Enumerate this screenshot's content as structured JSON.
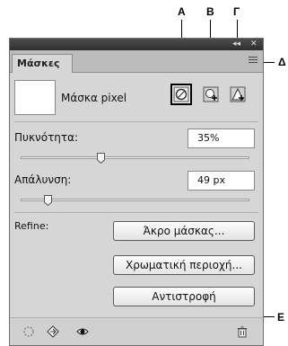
{
  "callouts": {
    "a": "A",
    "b": "B",
    "g": "Γ",
    "d": "Δ",
    "e": "E"
  },
  "panel": {
    "title_buttons": {
      "collapse": "◂◂",
      "close": "✕"
    },
    "tab_label": "Μάσκες",
    "mask_type": "Μάσκα pixel",
    "icons": {
      "pixel_mask": "pixel-mask-icon",
      "add_pixel_mask": "add-pixel-mask-icon",
      "add_vector_mask": "add-vector-mask-icon",
      "panel_menu": "panel-menu-icon"
    },
    "density": {
      "label": "Πυκνότητα:",
      "value": "35%",
      "fraction": 0.35
    },
    "feather": {
      "label": "Απάλυνση:",
      "value": "49 px",
      "fraction": 0.12
    },
    "refine": {
      "label": "Refine:",
      "mask_edge": "Άκρο μάσκας...",
      "color_range": "Χρωματική περιοχή...",
      "invert": "Αντιστροφή"
    },
    "bottom_icons": [
      "load-selection-icon",
      "apply-mask-icon",
      "visibility-eye-icon",
      "trash-icon"
    ]
  }
}
